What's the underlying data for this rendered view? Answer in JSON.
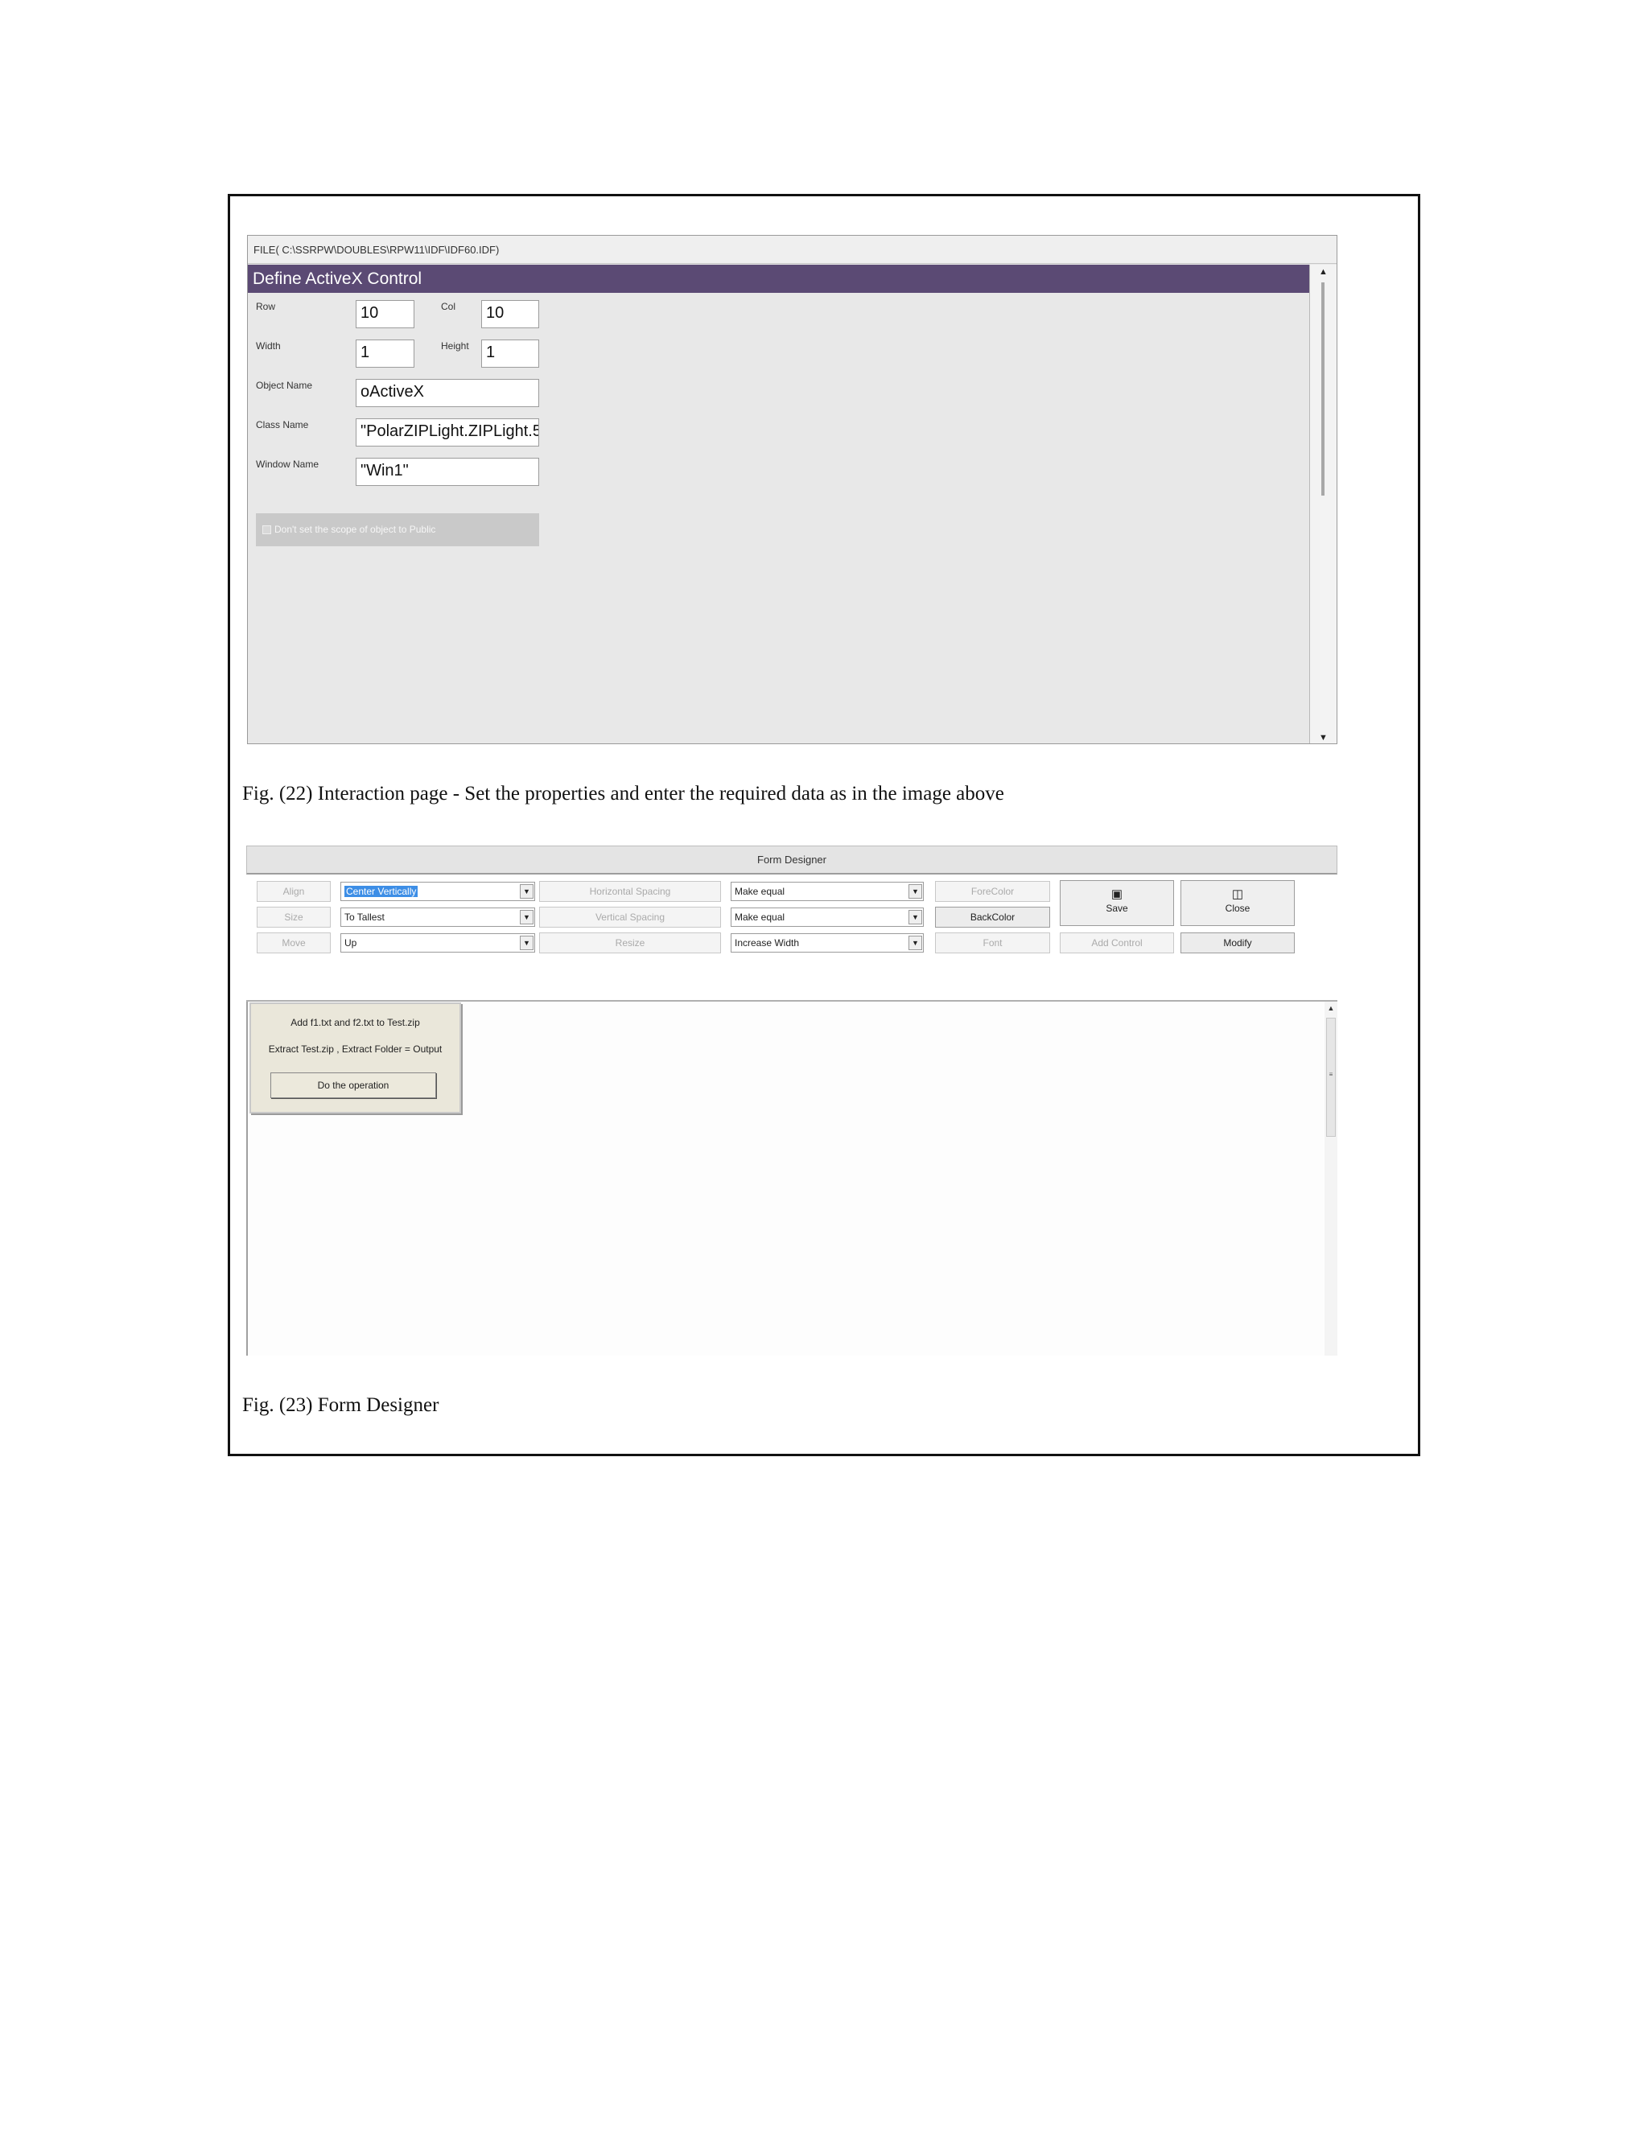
{
  "fig22": {
    "file_path": "FILE( C:\\SSRPW\\DOUBLES\\RPW11\\IDF\\IDF60.IDF)",
    "title": "Define ActiveX Control",
    "fields": {
      "row_label": "Row",
      "row_value": "10",
      "col_label": "Col",
      "col_value": "10",
      "width_label": "Width",
      "width_value": "1",
      "height_label": "Height",
      "height_value": "1",
      "object_name_label": "Object Name",
      "object_name_value": "oActiveX",
      "class_name_label": "Class Name",
      "class_name_value": "\"PolarZIPLight.ZIPLight.5\"",
      "window_name_label": "Window Name",
      "window_name_value": "\"Win1\""
    },
    "checkbox_label": "Don't set the scope of object to Public",
    "scroll_up": "▲",
    "scroll_down": "▼"
  },
  "caption22": "Fig. (22) Interaction page - Set the properties and enter the required data as in the image above",
  "fig23": {
    "title": "Form Designer",
    "toolbar": {
      "align_label": "Align",
      "align_value": "Center Vertically",
      "size_label": "Size",
      "size_value": "To Tallest",
      "move_label": "Move",
      "move_value": "Up",
      "hspacing_label": "Horizontal Spacing",
      "hspacing_value": "Make equal",
      "vspacing_label": "Vertical Spacing",
      "vspacing_value": "Make equal",
      "resize_label": "Resize",
      "resize_value": "Increase Width",
      "forecolor_label": "ForeColor",
      "backcolor_label": "BackColor",
      "font_label": "Font",
      "save_label": "Save",
      "close_label": "Close",
      "add_control_label": "Add Control",
      "modify_label": "Modify",
      "dropdown_arrow": "▼",
      "save_icon": "floppy-disk-icon",
      "close_icon": "folder-exit-icon"
    },
    "preview": {
      "line1": "Add f1.txt and f2.txt to Test.zip",
      "line2": "Extract Test.zip , Extract Folder = Output",
      "button_label": "Do the operation"
    },
    "scroll_up": "▲",
    "scroll_grip": "≡"
  },
  "caption23": "Fig. (23) Form Designer",
  "colors": {
    "titlebar": "#5b4a74",
    "selection": "#3d8ee6",
    "preview_bg": "#eae7da"
  }
}
